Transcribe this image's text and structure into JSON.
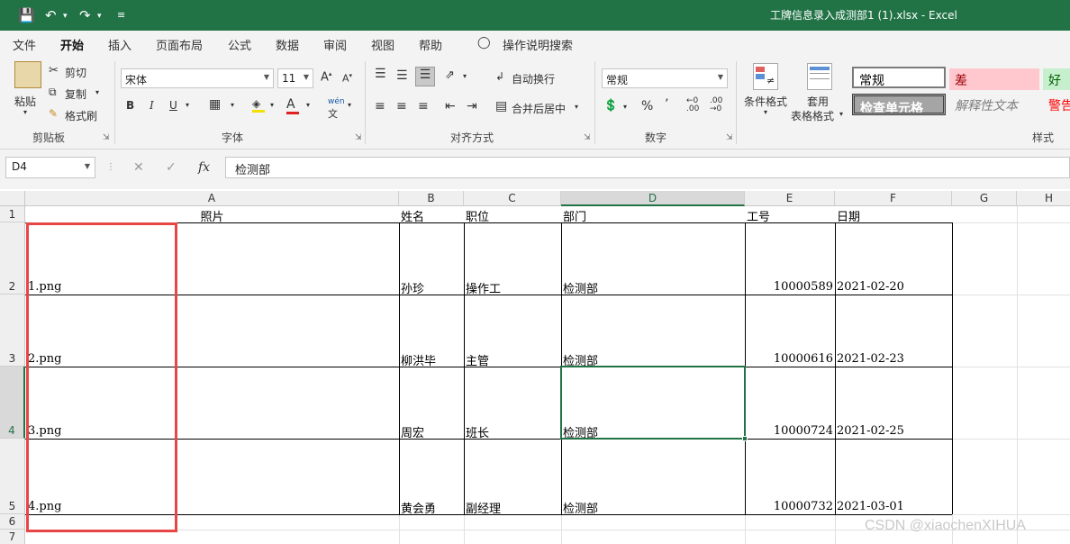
{
  "window": {
    "title": "工牌信息录入成测部1 (1).xlsx  -  Excel"
  },
  "menu": {
    "tabs": [
      "文件",
      "开始",
      "插入",
      "页面布局",
      "公式",
      "数据",
      "审阅",
      "视图",
      "帮助"
    ],
    "active": "开始",
    "tell_me": "操作说明搜索"
  },
  "ribbon": {
    "clipboard": {
      "paste": "粘贴",
      "cut": "剪切",
      "copy": "复制",
      "format_painter": "格式刷",
      "label": "剪贴板"
    },
    "font": {
      "name": "宋体",
      "size": "11",
      "bold": "B",
      "italic": "I",
      "underline": "U",
      "label": "字体"
    },
    "alignment": {
      "wrap": "自动换行",
      "merge": "合并后居中",
      "label": "对齐方式"
    },
    "number": {
      "format": "常规",
      "percent": "%",
      "comma": "’",
      "label": "数字"
    },
    "styles": {
      "conditional": "条件格式",
      "table_format_1": "套用",
      "table_format_2": "表格格式",
      "normal": "常规",
      "bad": "差",
      "good": "好",
      "check_cell": "检查单元格",
      "explanatory": "解释性文本",
      "warning": "警告",
      "label": "样式"
    }
  },
  "formula_bar": {
    "name_box": "D4",
    "content": "检测部",
    "fx": "fx"
  },
  "sheet": {
    "columns": [
      "A",
      "B",
      "C",
      "D",
      "E",
      "F",
      "G",
      "H"
    ],
    "rows": [
      "1",
      "2",
      "3",
      "4",
      "5",
      "6",
      "7"
    ],
    "header": {
      "photo": "照片",
      "name": "姓名",
      "position": "职位",
      "dept": "部门",
      "id": "工号",
      "date": "日期"
    },
    "data": [
      {
        "photo": "1.png",
        "name": "孙珍",
        "position": "操作工",
        "dept": "检测部",
        "id": "10000589",
        "date": "2021-02-20"
      },
      {
        "photo": "2.png",
        "name": "柳洪毕",
        "position": "主管",
        "dept": "检测部",
        "id": "10000616",
        "date": "2021-02-23"
      },
      {
        "photo": "3.png",
        "name": "周宏",
        "position": "班长",
        "dept": "检测部",
        "id": "10000724",
        "date": "2021-02-25"
      },
      {
        "photo": "4.png",
        "name": "黄会勇",
        "position": "副经理",
        "dept": "检测部",
        "id": "10000732",
        "date": "2021-03-01"
      }
    ]
  },
  "watermark": "CSDN @xiaochenXIHUA",
  "colors": {
    "excel_green": "#217346",
    "highlight_red": "#e84545"
  }
}
